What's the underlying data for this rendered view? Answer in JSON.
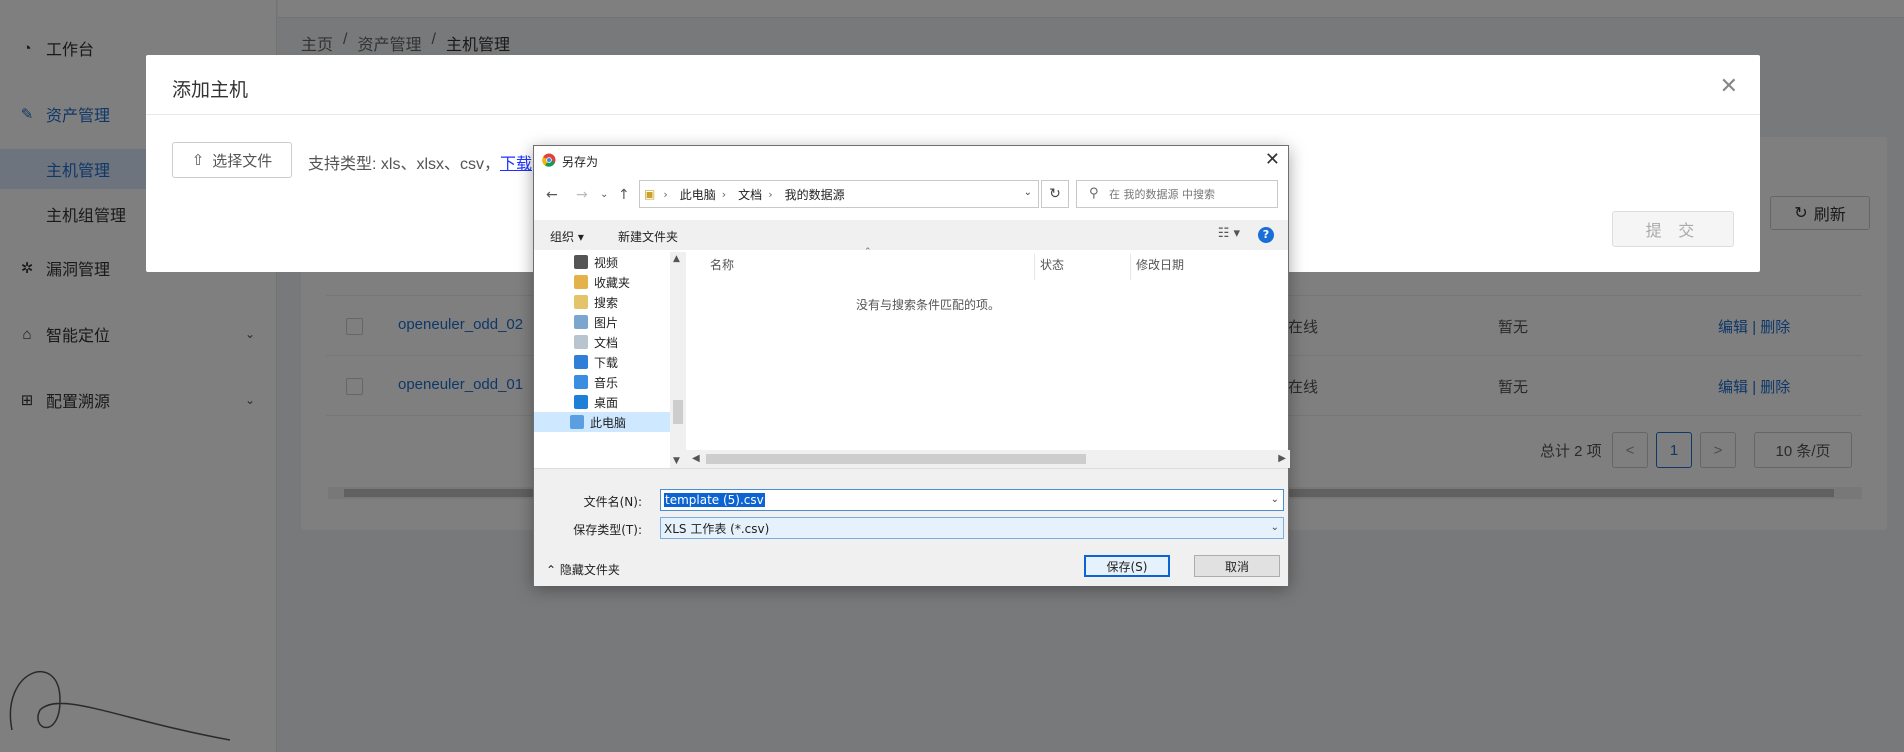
{
  "sidebar": {
    "items": [
      {
        "label": "工作台",
        "icon": "dashboard-icon"
      },
      {
        "label": "资产管理",
        "icon": "edit-icon"
      },
      {
        "label": "主机管理"
      },
      {
        "label": "主机组管理"
      },
      {
        "label": "漏洞管理",
        "icon": "bug-icon"
      },
      {
        "label": "智能定位",
        "icon": "locate-icon"
      },
      {
        "label": "配置溯源",
        "icon": "tree-icon"
      }
    ]
  },
  "breadcrumb": [
    "主页",
    "/",
    "资产管理",
    "/",
    "主机管理"
  ],
  "toolbar": {
    "refresh_label": "刷新"
  },
  "table": {
    "rows": [
      {
        "name": "openeuler_odd_02",
        "status": "在线",
        "note": "暂无",
        "edit": "编辑",
        "sep": "|",
        "delete": "删除"
      },
      {
        "name": "openeuler_odd_01",
        "status": "在线",
        "note": "暂无",
        "edit": "编辑",
        "sep": "|",
        "delete": "删除"
      }
    ]
  },
  "pagination": {
    "total": "总计 2 项",
    "prev": "<",
    "page": "1",
    "next": ">",
    "size": "10 条/页"
  },
  "modal": {
    "title": "添加主机",
    "upload_label": "选择文件",
    "hint": "支持类型: xls、xlsx、csv，",
    "download_link": "下载",
    "submit_label": "提 交"
  },
  "dialog": {
    "title": "另存为",
    "path": [
      "此电脑",
      "文档",
      "我的数据源"
    ],
    "search_placeholder": "在 我的数据源 中搜索",
    "organize": "组织 ▾",
    "new_folder": "新建文件夹",
    "tree": [
      "视频",
      "收藏夹",
      "搜索",
      "图片",
      "文档",
      "下载",
      "音乐",
      "桌面",
      "此电脑"
    ],
    "columns": [
      "名称",
      "状态",
      "修改日期"
    ],
    "empty_text": "没有与搜索条件匹配的项。",
    "filename_label": "文件名(N):",
    "filename_value": "template (5).csv",
    "filetype_label": "保存类型(T):",
    "filetype_value": "XLS 工作表 (*.csv)",
    "hide_folders": "隐藏文件夹",
    "save_label": "保存(S)",
    "cancel_label": "取消",
    "help": "?"
  }
}
